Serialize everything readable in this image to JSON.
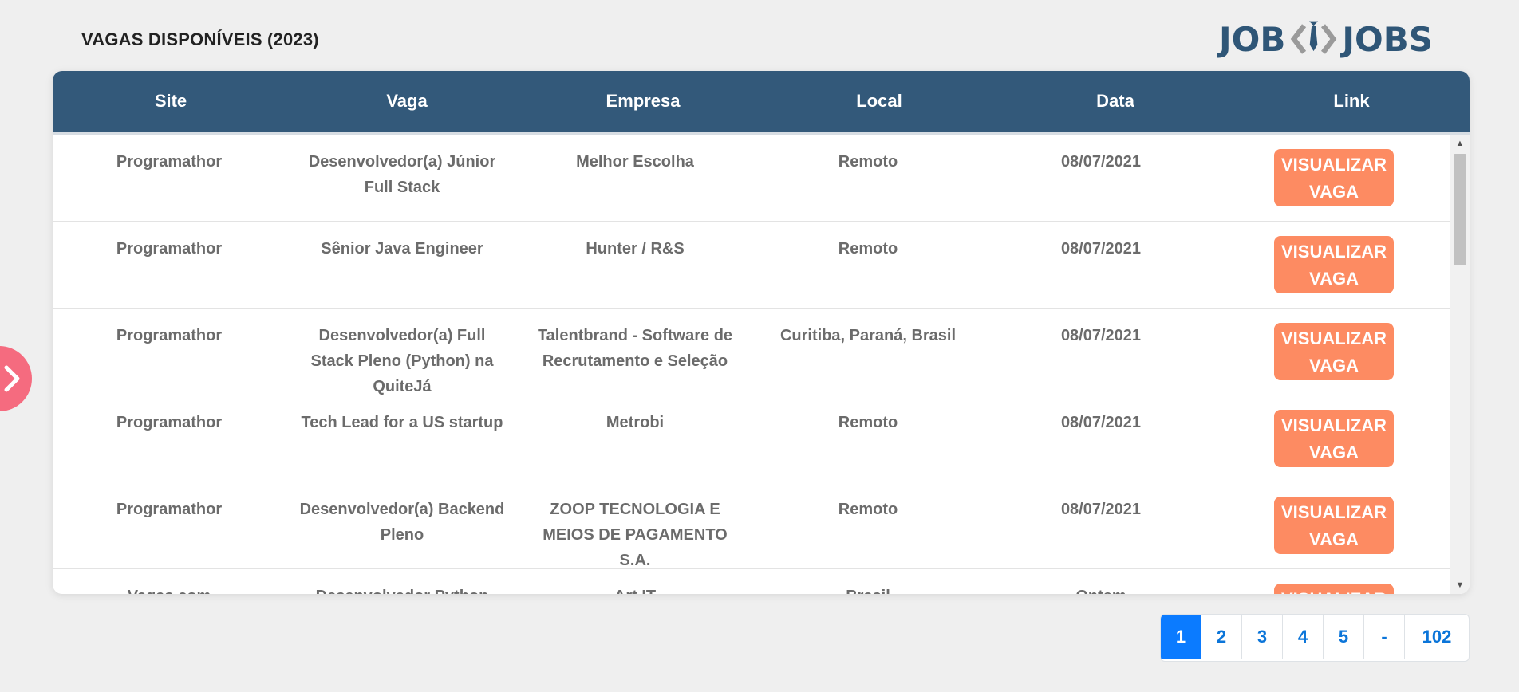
{
  "page": {
    "title": "VAGAS DISPONÍVEIS (2023)"
  },
  "logo": {
    "left": "JOB",
    "right": "JOBS"
  },
  "table": {
    "headers": [
      "Site",
      "Vaga",
      "Empresa",
      "Local",
      "Data",
      "Link"
    ],
    "rows": [
      {
        "site": "Programathor",
        "vaga": "Desenvolvedor(a) Júnior Full Stack",
        "empresa": "Melhor Escolha",
        "local": "Remoto",
        "data": "08/07/2021",
        "link": "VISUALIZAR VAGA"
      },
      {
        "site": "Programathor",
        "vaga": "Sênior Java Engineer",
        "empresa": "Hunter / R&S",
        "local": "Remoto",
        "data": "08/07/2021",
        "link": "VISUALIZAR VAGA"
      },
      {
        "site": "Programathor",
        "vaga": "Desenvolvedor(a) Full Stack Pleno (Python) na QuiteJá",
        "empresa": "Talentbrand - Software de Recrutamento e Seleção",
        "local": "Curitiba, Paraná, Brasil",
        "data": "08/07/2021",
        "link": "VISUALIZAR VAGA"
      },
      {
        "site": "Programathor",
        "vaga": "Tech Lead for a US startup",
        "empresa": "Metrobi",
        "local": "Remoto",
        "data": "08/07/2021",
        "link": "VISUALIZAR VAGA"
      },
      {
        "site": "Programathor",
        "vaga": "Desenvolvedor(a) Backend Pleno",
        "empresa": "ZOOP TECNOLOGIA E MEIOS DE PAGAMENTO S.A.",
        "local": "Remoto",
        "data": "08/07/2021",
        "link": "VISUALIZAR VAGA"
      },
      {
        "site": "Vagas.com",
        "vaga": "Desenvolvedor Python",
        "empresa": "Art IT",
        "local": "Brasil",
        "data": "Ontem",
        "link": "VISUALIZAR VAGA"
      }
    ]
  },
  "pagination": {
    "pages": [
      "1",
      "2",
      "3",
      "4",
      "5",
      "-",
      "102"
    ],
    "active": "1"
  },
  "colors": {
    "header_bg": "#33597a",
    "button_bg": "#fd8b62",
    "accent": "#0b7bff",
    "toggle": "#f56b7f"
  }
}
